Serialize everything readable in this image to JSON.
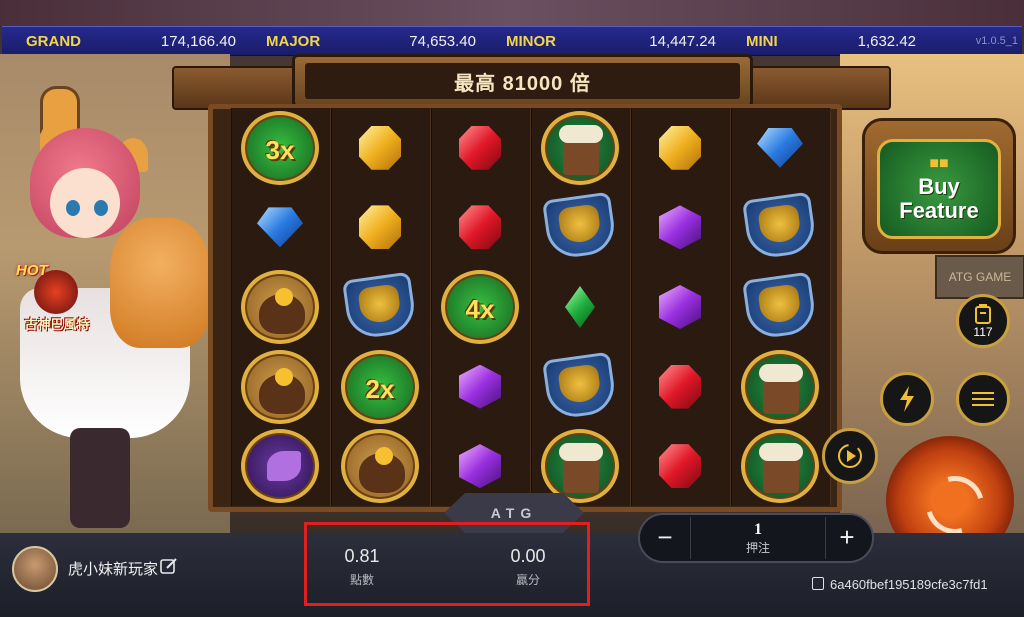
{
  "jackpots": [
    {
      "name": "GRAND",
      "value": "174,166.40"
    },
    {
      "name": "MAJOR",
      "value": "74,653.40"
    },
    {
      "name": "MINOR",
      "value": "14,447.24"
    },
    {
      "name": "MINI",
      "value": "1,632.42"
    }
  ],
  "version": "v1.0.5_1",
  "title": "最高 81000 倍",
  "hot_badge": {
    "tag": "HOT",
    "label": "古神巴風特"
  },
  "reels": [
    [
      "mult-3x",
      "yellow-gem",
      "red-gem",
      "mug",
      "yellow-gem",
      "blue-gem"
    ],
    [
      "blue-gem",
      "yellow-gem",
      "red-gem",
      "shield",
      "purple-gem",
      "shield"
    ],
    [
      "bag",
      "shield",
      "mult-4x",
      "green-gem",
      "purple-gem",
      "shield"
    ],
    [
      "bag",
      "mult-2x",
      "purple-gem",
      "shield",
      "red-gem",
      "mug"
    ],
    [
      "axe",
      "bag",
      "purple-gem",
      "mug",
      "red-gem",
      "mug"
    ]
  ],
  "multipliers": {
    "m3": "3x",
    "m4": "4x",
    "m2": "2x"
  },
  "provider_logo": "ATG",
  "buy_feature": {
    "label_line1": "Buy",
    "label_line2": "Feature"
  },
  "autoplay_count": "117",
  "sign_text": "ATG GAME",
  "player": {
    "name": "虎小妹新玩家"
  },
  "balance": {
    "value": "0.81",
    "label": "點數"
  },
  "win": {
    "value": "0.00",
    "label": "贏分"
  },
  "bet": {
    "value": "1",
    "label": "押注",
    "minus": "−",
    "plus": "+"
  },
  "session_id": "6a460fbef195189cfe3c7fd1",
  "colors": {
    "jackpot_name": "#f2d64a",
    "accent_gold": "#e0b040",
    "highlight": "#e02020"
  }
}
